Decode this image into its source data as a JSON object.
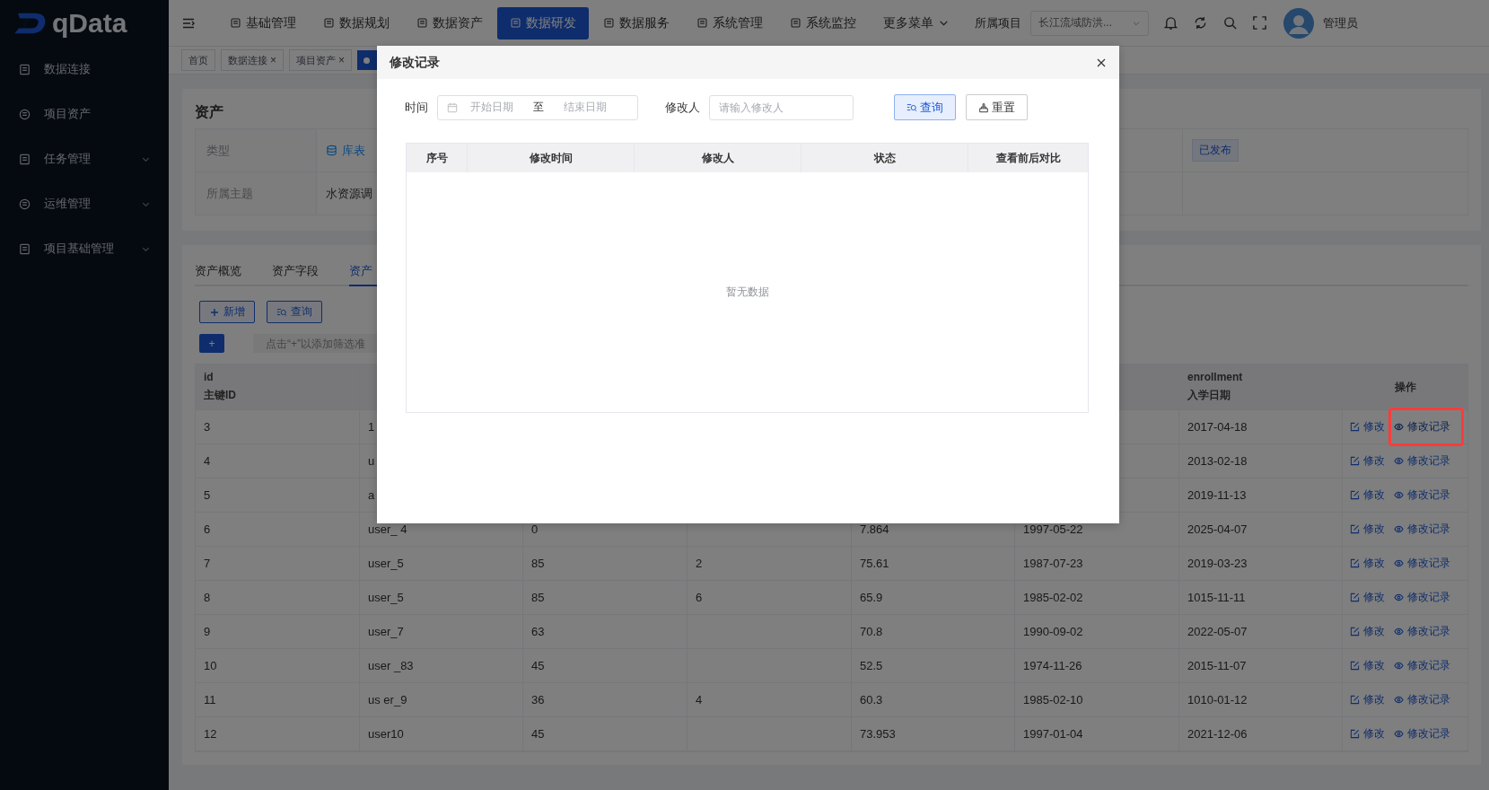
{
  "app": {
    "logo": "qData"
  },
  "top_nav": {
    "items": [
      {
        "label": "基础管理",
        "selected": false
      },
      {
        "label": "数据规划",
        "selected": false
      },
      {
        "label": "数据资产",
        "selected": false
      },
      {
        "label": "数据研发",
        "selected": true
      },
      {
        "label": "数据服务",
        "selected": false
      },
      {
        "label": "系统管理",
        "selected": false
      },
      {
        "label": "系统监控",
        "selected": false
      }
    ],
    "more": "更多菜单",
    "project_label": "所属项目",
    "project_value": "长江流域防洪...",
    "user": "管理员"
  },
  "sidebar": {
    "items": [
      {
        "label": "数据连接",
        "kind": "link"
      },
      {
        "label": "项目资产",
        "kind": "link"
      },
      {
        "label": "任务管理",
        "kind": "group"
      },
      {
        "label": "运维管理",
        "kind": "group"
      },
      {
        "label": "项目基础管理",
        "kind": "group"
      }
    ]
  },
  "tags": [
    {
      "label": "首页"
    },
    {
      "label": "数据连接",
      "close": "×"
    },
    {
      "label": "项目资产",
      "close": "×"
    }
  ],
  "asset": {
    "title": "资产",
    "type_label": "类型",
    "type_value": "库表",
    "status": "已发布",
    "theme_label": "所属主题",
    "theme_value": "水资源调"
  },
  "tabs": [
    {
      "label": "资产概览",
      "selected": false
    },
    {
      "label": "资产字段",
      "selected": false
    },
    {
      "label": "资产",
      "selected": true
    }
  ],
  "toolbar": {
    "add": "新增",
    "query": "查询",
    "plus": "+",
    "filter_placeholder": "点击“+”以添加筛选准"
  },
  "table": {
    "columns": [
      {
        "name": "id",
        "label": "主键ID"
      },
      null,
      null,
      null,
      null,
      null,
      {
        "name": "enrollment",
        "label": "入学日期"
      }
    ],
    "action_header": "操作",
    "rows": [
      {
        "cells": [
          "3",
          "1",
          null,
          null,
          null,
          null,
          "2017-04-18"
        ],
        "edit": "修改",
        "history": "修改记录",
        "highlighted": true
      },
      {
        "cells": [
          "4",
          "u",
          null,
          null,
          null,
          null,
          "2013-02-18"
        ],
        "edit": "修改",
        "history": "修改记录",
        "highlighted": false
      },
      {
        "cells": [
          "5",
          "a",
          null,
          null,
          null,
          null,
          "2019-11-13"
        ],
        "edit": "修改",
        "history": "修改记录",
        "highlighted": false
      },
      {
        "cells": [
          "6",
          "user_ 4",
          "0",
          null,
          "7.864",
          "1997-05-22",
          "2025-04-07"
        ],
        "edit": "修改",
        "history": "修改记录",
        "highlighted": false
      },
      {
        "cells": [
          "7",
          "user_5",
          "85",
          "2",
          "75.61",
          "1987-07-23",
          "2019-03-23"
        ],
        "edit": "修改",
        "history": "修改记录",
        "highlighted": false
      },
      {
        "cells": [
          "8",
          "user_5",
          "85",
          "6",
          "65.9",
          "1985-02-02",
          "1015-11-11"
        ],
        "edit": "修改",
        "history": "修改记录",
        "highlighted": false
      },
      {
        "cells": [
          "9",
          "user_7",
          "63",
          null,
          "70.8",
          "1990-09-02",
          "2022-05-07"
        ],
        "edit": "修改",
        "history": "修改记录",
        "highlighted": false
      },
      {
        "cells": [
          "10",
          "user _83",
          "45",
          null,
          "52.5",
          "1974-11-26",
          "2015-11-07"
        ],
        "edit": "修改",
        "history": "修改记录",
        "highlighted": false
      },
      {
        "cells": [
          "11",
          "us er_9",
          "36",
          "4",
          "60.3",
          "1985-02-10",
          "1010-01-12"
        ],
        "edit": "修改",
        "history": "修改记录",
        "highlighted": false
      },
      {
        "cells": [
          "12",
          "user10",
          "45",
          null,
          "73.953",
          "1997-01-04",
          "2021-12-06"
        ],
        "edit": "修改",
        "history": "修改记录",
        "highlighted": false
      }
    ]
  },
  "dialog": {
    "title": "修改记录",
    "time_label": "时间",
    "start_placeholder": "开始日期",
    "range_separator": "至",
    "end_placeholder": "结束日期",
    "editor_label": "修改人",
    "editor_placeholder": "请输入修改人",
    "query": "查询",
    "reset": "重置",
    "columns": [
      "序号",
      "修改时间",
      "修改人",
      "状态",
      "查看前后对比"
    ],
    "empty": "暂无数据"
  }
}
